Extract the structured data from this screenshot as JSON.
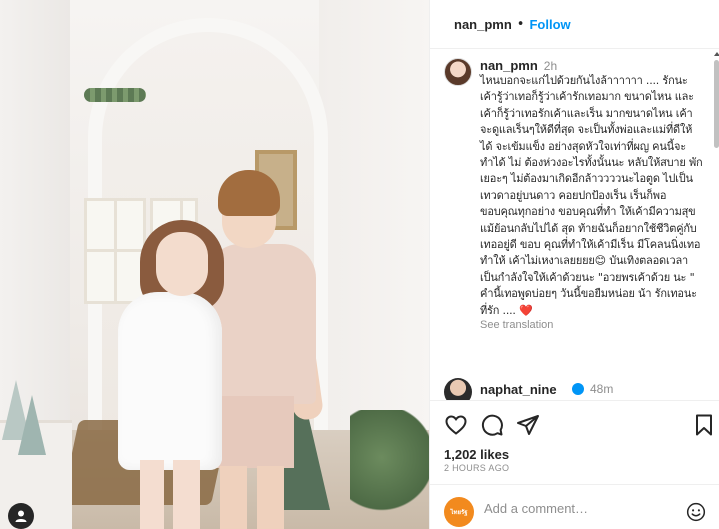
{
  "post": {
    "author": "nan_pmn",
    "separator": "•",
    "follow_label": "Follow"
  },
  "caption": {
    "username": "nan_pmn",
    "time": "2h",
    "text": "ไหนบอกจะแก่ไปด้วยกันไงล้าาาาาา .... รักนะ เค้ารู้ว่าเทอก็รู้ว่าเค้ารักเทอมาก ขนาดไหน และเค้าก็รู้ว่าเทอรักเค้าและเร็น มากขนาดไหน เค้าจะดูแลเร็นๆให้ดีที่สุด จะเป็นทั้งพ่อและแม่ที่ดีให้ได้ จะเข้มแข็ง อย่างสุดหัวใจเท่าที่ผญ คนนี้จะทำได้ ไม่ ต้องห่วงอะไรทั้งนั้นนะ หลับให้สบาย พัก เยอะๆ ไม่ต้องมาเกิดอีกล้าววววนะไอตูด ไปเป็นเทวดาอยู่บนดาว คอยปกป้องเร็น เร็นก็พอ ขอบคุณทุกอย่าง ขอบคุณที่ทำ ให้เค้ามีความสุข แม้ย้อนกลับไปได้ สุด ท้ายฉันก็อยากใช้ชีวิตคู่กับเทออยู่ดี ขอบ คุณที่ทำให้เค้ามีเร็น มีโคลนนิ่งเทอ ทำให้ เค้าไม่เหงาเลยยยย😊 บันเทิงตลอดเวลา เป็นกำลังใจให้เค้าด้วยนะ \"อวยพรเค้าด้วย นะ \" คำนี้เทอพูดบ่อยๆ วันนี้ขอยืมหน่อย น้า รักเทอนะ ที่รัก .... ❤️",
    "see_translation": "See translation"
  },
  "comment_preview": {
    "username": "naphat_nine",
    "time": "48m"
  },
  "actions": {
    "likes": "1,202 likes",
    "time_ago": "2 HOURS AGO"
  },
  "add_comment": {
    "placeholder": "Add a comment…",
    "avatar_text": "ไทยรัฐ"
  },
  "icons": {
    "like": "heart-icon",
    "comment": "comment-icon",
    "share": "paper-plane-icon",
    "save": "bookmark-icon",
    "emoji": "smiley-icon",
    "user": "user-icon",
    "verified": "verified-badge-icon"
  },
  "colors": {
    "accent": "#0095f6",
    "muted": "#8e8e8e",
    "heart": "#ed4956",
    "text": "#262626"
  }
}
